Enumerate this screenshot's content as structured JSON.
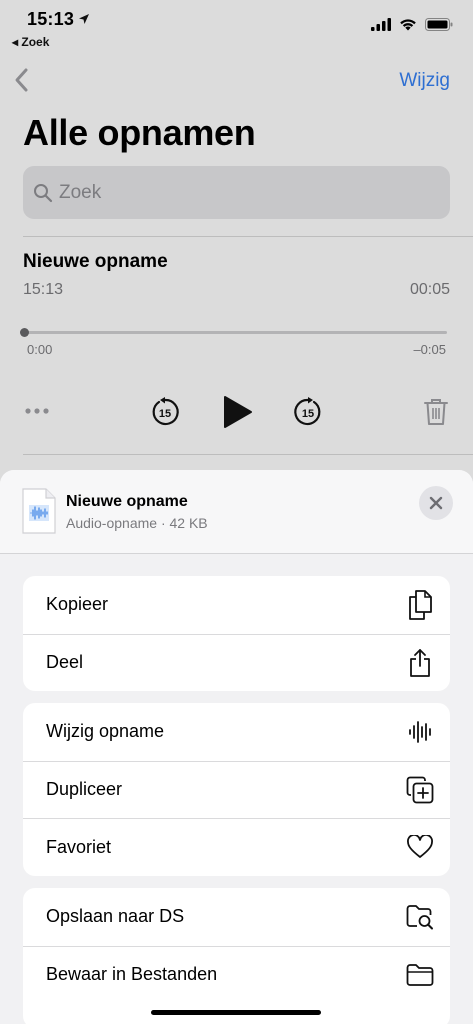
{
  "status_bar": {
    "time": "15:13",
    "back_app": "◂ Zoek"
  },
  "nav": {
    "edit_label": "Wijzig"
  },
  "page": {
    "title": "Alle opnamen"
  },
  "search": {
    "placeholder": "Zoek"
  },
  "recording": {
    "title": "Nieuwe opname",
    "time": "15:13",
    "duration": "00:05",
    "elapsed": "0:00",
    "remaining": "–0:05",
    "progress": 0
  },
  "sheet": {
    "file_name": "Nieuwe opname",
    "file_meta": "Audio-opname · 42 KB",
    "groups": [
      {
        "items": [
          {
            "label": "Kopieer",
            "icon": "copy-icon"
          },
          {
            "label": "Deel",
            "icon": "share-icon"
          }
        ]
      },
      {
        "items": [
          {
            "label": "Wijzig opname",
            "icon": "waveform-icon"
          },
          {
            "label": "Dupliceer",
            "icon": "duplicate-icon"
          },
          {
            "label": "Favoriet",
            "icon": "heart-icon"
          }
        ]
      },
      {
        "items": [
          {
            "label": "Opslaan naar DS",
            "icon": "folder-search-icon"
          },
          {
            "label": "Bewaar in Bestanden",
            "icon": "folder-icon"
          }
        ]
      }
    ]
  },
  "colors": {
    "accent": "#2e6fd2",
    "dim_background": "#dcdcdc",
    "sheet": "#f1f1f3"
  }
}
